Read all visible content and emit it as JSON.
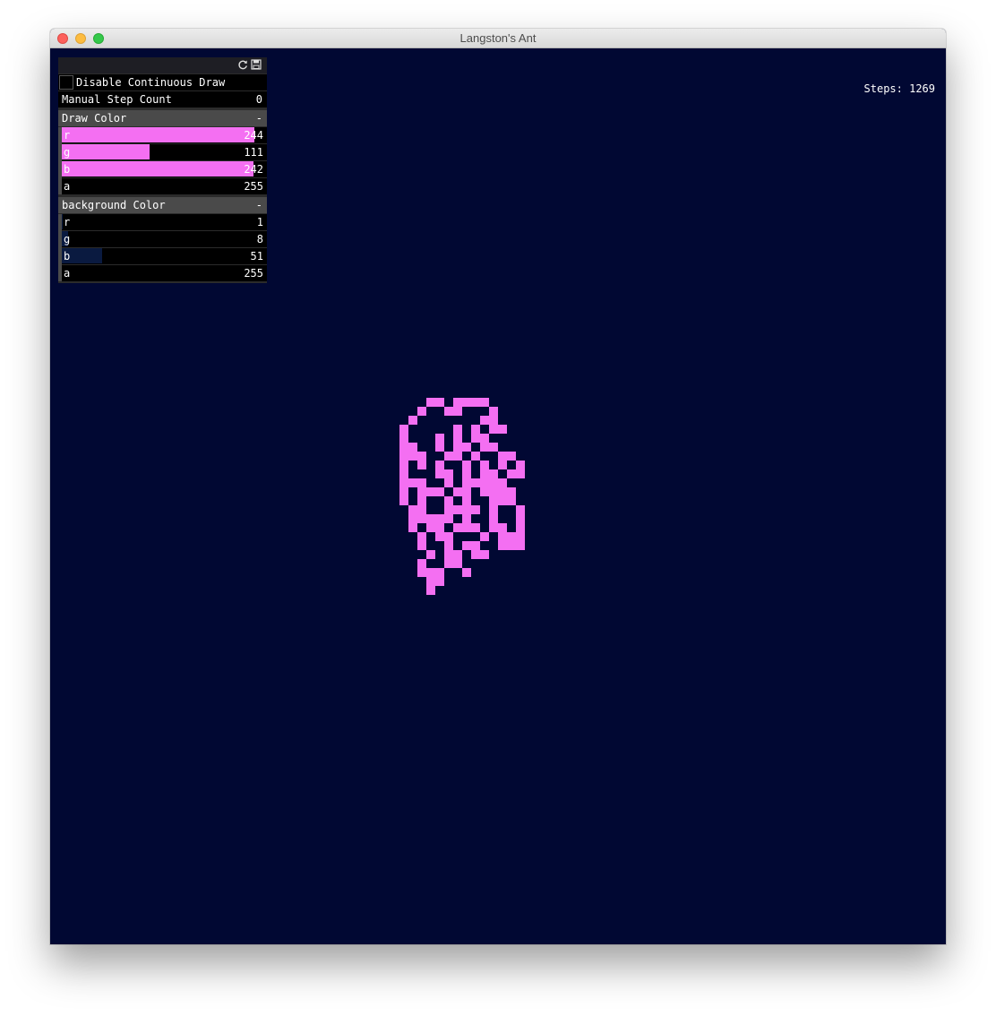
{
  "window": {
    "title": "Langston's Ant"
  },
  "hud": {
    "steps_text": "Steps: 1269"
  },
  "gui": {
    "icons": [
      "refresh-icon",
      "save-icon"
    ],
    "disable_draw": {
      "label": "Disable Continuous Draw",
      "checked": false
    },
    "manual_step": {
      "label": "Manual Step Count",
      "value": "0"
    },
    "draw_color": {
      "title": "Draw Color",
      "collapse": "-",
      "sliders": [
        {
          "label": "r",
          "value": 244,
          "max": 255,
          "text": "244"
        },
        {
          "label": "g",
          "value": 111,
          "max": 255,
          "text": "111"
        },
        {
          "label": "b",
          "value": 242,
          "max": 255,
          "text": "242"
        },
        {
          "label": "a",
          "value": 255,
          "max": 255,
          "text": "255"
        }
      ]
    },
    "background_color": {
      "title": "background Color",
      "collapse": "-",
      "sliders": [
        {
          "label": "r",
          "value": 1,
          "max": 255,
          "text": "1"
        },
        {
          "label": "g",
          "value": 8,
          "max": 255,
          "text": "8"
        },
        {
          "label": "b",
          "value": 51,
          "max": 255,
          "text": "51"
        },
        {
          "label": "a",
          "value": 255,
          "max": 255,
          "text": "255"
        }
      ]
    }
  },
  "colors": {
    "draw": "#f46ff2",
    "background": "#010833",
    "bg_slider_fill": "#0a1a40"
  },
  "ant_grid": {
    "cell_size": 10,
    "rows": [
      "...##.####....",
      "..#..##...#...",
      ".#.......##...",
      "#.....#.#.##..",
      "#...#.#.##....",
      "##..#.##.##...",
      "###..##.#..##.",
      "#.#.#..#.#.#.#",
      "#...##.#.##.##",
      "###..#.#####..",
      "#.###.##.####.",
      "#.#..#.#..###.",
      ".##..####.#..#",
      ".#####.#..#..#",
      ".#.##.###.##.#",
      "..#.##...#.###",
      "..#..#.##..###",
      "...#.##.##....",
      "..#..##.......",
      "..###..#......",
      "...##.........",
      "...#.........."
    ]
  }
}
